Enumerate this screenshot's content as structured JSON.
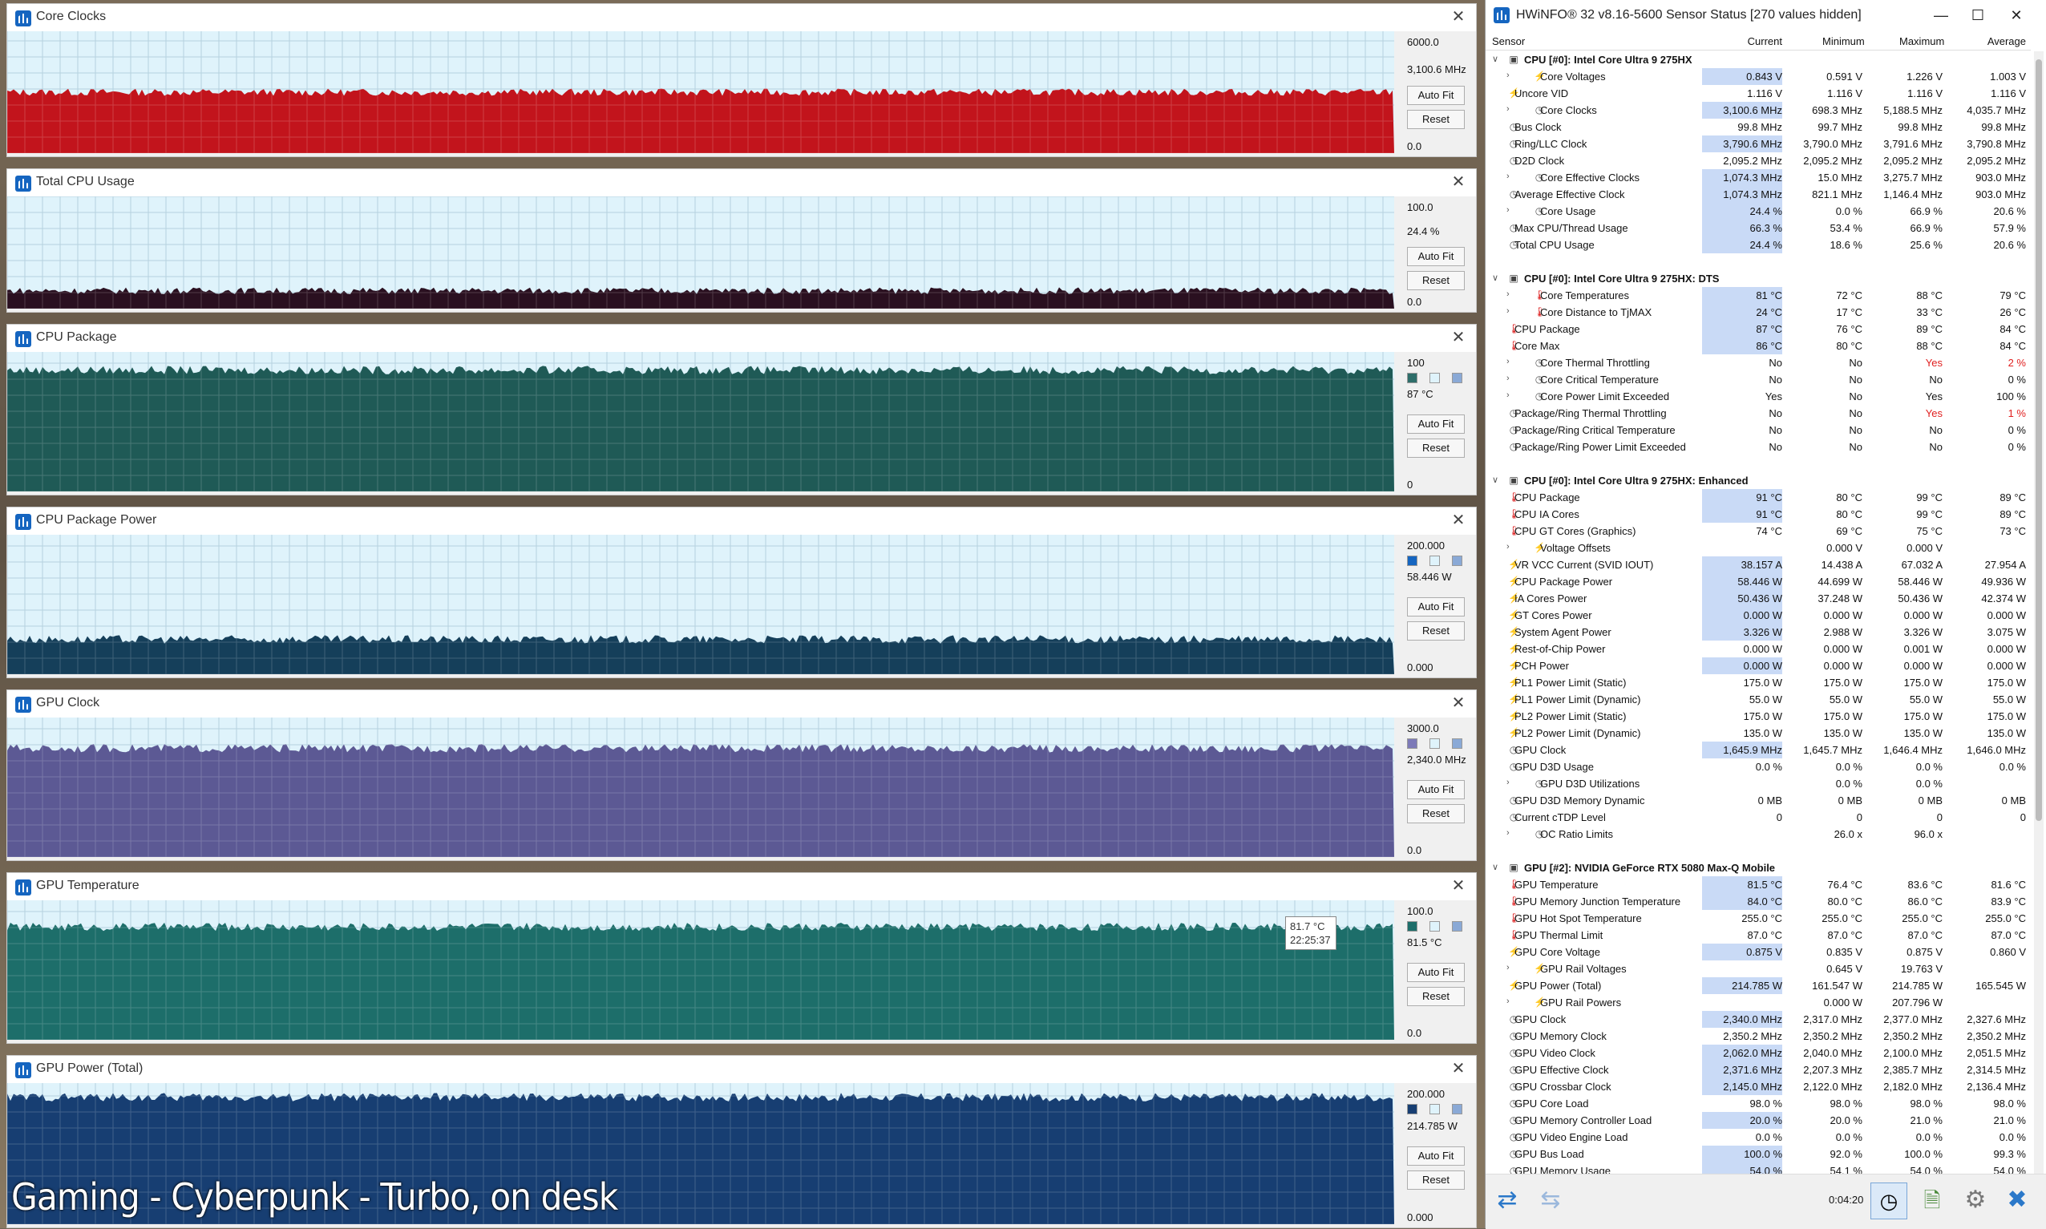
{
  "caption": "Gaming - Cyberpunk - Turbo, on desk",
  "graphs": [
    {
      "title": "Core Clocks",
      "max": "6000.0",
      "current": "3,100.6 MHz",
      "min": "0.0",
      "autofit": "Auto Fit",
      "reset": "Reset",
      "color": "#c2141c",
      "bg": "#dff3fb",
      "level": 0.5,
      "swatches": []
    },
    {
      "title": "Total CPU Usage",
      "max": "100.0",
      "current": "24.4 %",
      "min": "0.0",
      "autofit": "Auto Fit",
      "reset": "Reset",
      "color": "#2a1020",
      "bg": "#dff3fb",
      "level": 0.16,
      "swatches": []
    },
    {
      "title": "CPU Package",
      "max": "100",
      "current": "87 °C",
      "min": "0",
      "autofit": "Auto Fit",
      "reset": "Reset",
      "color": "#1f5a56",
      "bg": "#dff3fb",
      "level": 0.87,
      "swatches": [
        "#2e6e6a",
        "#dff3fb",
        "#8aa9d6"
      ]
    },
    {
      "title": "CPU Package Power",
      "max": "200.000",
      "current": "58.446 W",
      "min": "0.000",
      "autofit": "Auto Fit",
      "reset": "Reset",
      "color": "#153f5a",
      "bg": "#dff3fb",
      "level": 0.25,
      "swatches": [
        "#1565c0",
        "#dff3fb",
        "#8aa9d6"
      ]
    },
    {
      "title": "GPU Clock",
      "max": "3000.0",
      "current": "2,340.0 MHz",
      "min": "0.0",
      "autofit": "Auto Fit",
      "reset": "Reset",
      "color": "#5c5994",
      "bg": "#dff3fb",
      "level": 0.78,
      "swatches": [
        "#7d7ab8",
        "#dff3fb",
        "#8aa9d6"
      ]
    },
    {
      "title": "GPU Temperature",
      "max": "100.0",
      "current": "81.5 °C",
      "min": "0.0",
      "autofit": "Auto Fit",
      "reset": "Reset",
      "color": "#1d6e6a",
      "bg": "#dff3fb",
      "level": 0.81,
      "swatches": [
        "#1d6e6a",
        "#dff3fb",
        "#8aa9d6"
      ]
    },
    {
      "title": "GPU Power (Total)",
      "max": "200.000",
      "current": "214.785 W",
      "min": "0.000",
      "autofit": "Auto Fit",
      "reset": "Reset",
      "color": "#173e72",
      "bg": "#dff3fb",
      "level": 0.9,
      "swatches": [
        "#173e72",
        "#dff3fb",
        "#8aa9d6"
      ]
    }
  ],
  "tooltip": {
    "value": "81.7 °C",
    "time": "22:25:37"
  },
  "sensor": {
    "title": "HWiNFO® 32 v8.16-5600 Sensor Status [270 values hidden]",
    "columns": [
      "Sensor",
      "Current",
      "Minimum",
      "Maximum",
      "Average"
    ],
    "elapsed": "0:04:20",
    "rows": [
      {
        "g": 1,
        "n": "CPU [#0]: Intel Core Ultra 9 275HX"
      },
      {
        "e": 1,
        "i": "volt",
        "n": "Core Voltages",
        "c": "0.843 V",
        "mi": "0.591 V",
        "ma": "1.226 V",
        "a": "1.003 V",
        "h": 1
      },
      {
        "i": "volt",
        "n": "Uncore VID",
        "c": "1.116 V",
        "mi": "1.116 V",
        "ma": "1.116 V",
        "a": "1.116 V"
      },
      {
        "e": 1,
        "i": "clk",
        "n": "Core Clocks",
        "c": "3,100.6 MHz",
        "mi": "698.3 MHz",
        "ma": "5,188.5 MHz",
        "a": "4,035.7 MHz",
        "h": 1
      },
      {
        "i": "clk",
        "n": "Bus Clock",
        "c": "99.8 MHz",
        "mi": "99.7 MHz",
        "ma": "99.8 MHz",
        "a": "99.8 MHz"
      },
      {
        "i": "clk",
        "n": "Ring/LLC Clock",
        "c": "3,790.6 MHz",
        "mi": "3,790.0 MHz",
        "ma": "3,791.6 MHz",
        "a": "3,790.8 MHz",
        "h": 1
      },
      {
        "i": "clk",
        "n": "D2D Clock",
        "c": "2,095.2 MHz",
        "mi": "2,095.2 MHz",
        "ma": "2,095.2 MHz",
        "a": "2,095.2 MHz"
      },
      {
        "e": 1,
        "i": "clk",
        "n": "Core Effective Clocks",
        "c": "1,074.3 MHz",
        "mi": "15.0 MHz",
        "ma": "3,275.7 MHz",
        "a": "903.0 MHz",
        "h": 1
      },
      {
        "i": "clk",
        "n": "Average Effective Clock",
        "c": "1,074.3 MHz",
        "mi": "821.1 MHz",
        "ma": "1,146.4 MHz",
        "a": "903.0 MHz",
        "h": 1
      },
      {
        "e": 1,
        "i": "clk",
        "n": "Core Usage",
        "c": "24.4 %",
        "mi": "0.0 %",
        "ma": "66.9 %",
        "a": "20.6 %",
        "h": 1
      },
      {
        "i": "clk",
        "n": "Max CPU/Thread Usage",
        "c": "66.3 %",
        "mi": "53.4 %",
        "ma": "66.9 %",
        "a": "57.9 %",
        "h": 1
      },
      {
        "i": "clk",
        "n": "Total CPU Usage",
        "c": "24.4 %",
        "mi": "18.6 %",
        "ma": "25.6 %",
        "a": "20.6 %",
        "h": 1
      },
      {
        "s": 1
      },
      {
        "g": 1,
        "n": "CPU [#0]: Intel Core Ultra 9 275HX: DTS"
      },
      {
        "e": 1,
        "i": "temp",
        "n": "Core Temperatures",
        "c": "81 °C",
        "mi": "72 °C",
        "ma": "88 °C",
        "a": "79 °C",
        "h": 1
      },
      {
        "e": 1,
        "i": "temp",
        "n": "Core Distance to TjMAX",
        "c": "24 °C",
        "mi": "17 °C",
        "ma": "33 °C",
        "a": "26 °C",
        "h": 1
      },
      {
        "i": "temp",
        "n": "CPU Package",
        "c": "87 °C",
        "mi": "76 °C",
        "ma": "89 °C",
        "a": "84 °C",
        "h": 1
      },
      {
        "i": "temp",
        "n": "Core Max",
        "c": "86 °C",
        "mi": "80 °C",
        "ma": "88 °C",
        "a": "84 °C",
        "h": 1
      },
      {
        "e": 1,
        "i": "clk",
        "n": "Core Thermal Throttling",
        "c": "No",
        "mi": "No",
        "ma": "Yes",
        "a": "2 %",
        "r": 1
      },
      {
        "e": 1,
        "i": "clk",
        "n": "Core Critical Temperature",
        "c": "No",
        "mi": "No",
        "ma": "No",
        "a": "0 %"
      },
      {
        "e": 1,
        "i": "clk",
        "n": "Core Power Limit Exceeded",
        "c": "Yes",
        "mi": "No",
        "ma": "Yes",
        "a": "100 %"
      },
      {
        "i": "clk",
        "n": "Package/Ring Thermal Throttling",
        "c": "No",
        "mi": "No",
        "ma": "Yes",
        "a": "1 %",
        "r": 1
      },
      {
        "i": "clk",
        "n": "Package/Ring Critical Temperature",
        "c": "No",
        "mi": "No",
        "ma": "No",
        "a": "0 %"
      },
      {
        "i": "clk",
        "n": "Package/Ring Power Limit Exceeded",
        "c": "No",
        "mi": "No",
        "ma": "No",
        "a": "0 %"
      },
      {
        "s": 1
      },
      {
        "g": 1,
        "n": "CPU [#0]: Intel Core Ultra 9 275HX: Enhanced"
      },
      {
        "i": "temp",
        "n": "CPU Package",
        "c": "91 °C",
        "mi": "80 °C",
        "ma": "99 °C",
        "a": "89 °C",
        "h": 1
      },
      {
        "i": "temp",
        "n": "CPU IA Cores",
        "c": "91 °C",
        "mi": "80 °C",
        "ma": "99 °C",
        "a": "89 °C",
        "h": 1
      },
      {
        "i": "temp",
        "n": "CPU GT Cores (Graphics)",
        "c": "74 °C",
        "mi": "69 °C",
        "ma": "75 °C",
        "a": "73 °C"
      },
      {
        "e": 1,
        "i": "volt",
        "n": "Voltage Offsets",
        "c": "",
        "mi": "0.000 V",
        "ma": "0.000 V",
        "a": ""
      },
      {
        "i": "volt",
        "n": "VR VCC Current (SVID IOUT)",
        "c": "38.157 A",
        "mi": "14.438 A",
        "ma": "67.032 A",
        "a": "27.954 A",
        "h": 1
      },
      {
        "i": "volt",
        "n": "CPU Package Power",
        "c": "58.446 W",
        "mi": "44.699 W",
        "ma": "58.446 W",
        "a": "49.936 W",
        "h": 1
      },
      {
        "i": "volt",
        "n": "IA Cores Power",
        "c": "50.436 W",
        "mi": "37.248 W",
        "ma": "50.436 W",
        "a": "42.374 W",
        "h": 1
      },
      {
        "i": "volt",
        "n": "GT Cores Power",
        "c": "0.000 W",
        "mi": "0.000 W",
        "ma": "0.000 W",
        "a": "0.000 W",
        "h": 1
      },
      {
        "i": "volt",
        "n": "System Agent Power",
        "c": "3.326 W",
        "mi": "2.988 W",
        "ma": "3.326 W",
        "a": "3.075 W",
        "h": 1
      },
      {
        "i": "volt",
        "n": "Rest-of-Chip Power",
        "c": "0.000 W",
        "mi": "0.000 W",
        "ma": "0.001 W",
        "a": "0.000 W"
      },
      {
        "i": "volt",
        "n": "PCH Power",
        "c": "0.000 W",
        "mi": "0.000 W",
        "ma": "0.000 W",
        "a": "0.000 W",
        "h": 1
      },
      {
        "i": "volt",
        "n": "PL1 Power Limit (Static)",
        "c": "175.0 W",
        "mi": "175.0 W",
        "ma": "175.0 W",
        "a": "175.0 W"
      },
      {
        "i": "volt",
        "n": "PL1 Power Limit (Dynamic)",
        "c": "55.0 W",
        "mi": "55.0 W",
        "ma": "55.0 W",
        "a": "55.0 W"
      },
      {
        "i": "volt",
        "n": "PL2 Power Limit (Static)",
        "c": "175.0 W",
        "mi": "175.0 W",
        "ma": "175.0 W",
        "a": "175.0 W"
      },
      {
        "i": "volt",
        "n": "PL2 Power Limit (Dynamic)",
        "c": "135.0 W",
        "mi": "135.0 W",
        "ma": "135.0 W",
        "a": "135.0 W"
      },
      {
        "i": "clk",
        "n": "GPU Clock",
        "c": "1,645.9 MHz",
        "mi": "1,645.7 MHz",
        "ma": "1,646.4 MHz",
        "a": "1,646.0 MHz",
        "h": 1
      },
      {
        "i": "clk",
        "n": "GPU D3D Usage",
        "c": "0.0 %",
        "mi": "0.0 %",
        "ma": "0.0 %",
        "a": "0.0 %"
      },
      {
        "e": 1,
        "i": "clk",
        "n": "GPU D3D Utilizations",
        "c": "",
        "mi": "0.0 %",
        "ma": "0.0 %",
        "a": ""
      },
      {
        "i": "clk",
        "n": "GPU D3D Memory Dynamic",
        "c": "0 MB",
        "mi": "0 MB",
        "ma": "0 MB",
        "a": "0 MB"
      },
      {
        "i": "clk",
        "n": "Current cTDP Level",
        "c": "0",
        "mi": "0",
        "ma": "0",
        "a": "0"
      },
      {
        "e": 1,
        "i": "clk",
        "n": "OC Ratio Limits",
        "c": "",
        "mi": "26.0 x",
        "ma": "96.0 x",
        "a": ""
      },
      {
        "s": 1
      },
      {
        "g": 1,
        "n": "GPU [#2]: NVIDIA  GeForce RTX 5080 Max-Q Mobile"
      },
      {
        "i": "temp",
        "n": "GPU Temperature",
        "c": "81.5 °C",
        "mi": "76.4 °C",
        "ma": "83.6 °C",
        "a": "81.6 °C",
        "h": 1
      },
      {
        "i": "temp",
        "n": "GPU Memory Junction Temperature",
        "c": "84.0 °C",
        "mi": "80.0 °C",
        "ma": "86.0 °C",
        "a": "83.9 °C",
        "h": 1
      },
      {
        "i": "temp",
        "n": "GPU Hot Spot Temperature",
        "c": "255.0 °C",
        "mi": "255.0 °C",
        "ma": "255.0 °C",
        "a": "255.0 °C"
      },
      {
        "i": "temp",
        "n": "GPU Thermal Limit",
        "c": "87.0 °C",
        "mi": "87.0 °C",
        "ma": "87.0 °C",
        "a": "87.0 °C"
      },
      {
        "i": "volt",
        "n": "GPU Core Voltage",
        "c": "0.875 V",
        "mi": "0.835 V",
        "ma": "0.875 V",
        "a": "0.860 V",
        "h": 1
      },
      {
        "e": 1,
        "i": "volt",
        "n": "GPU Rail Voltages",
        "c": "",
        "mi": "0.645 V",
        "ma": "19.763 V",
        "a": ""
      },
      {
        "i": "volt",
        "n": "GPU Power (Total)",
        "c": "214.785 W",
        "mi": "161.547 W",
        "ma": "214.785 W",
        "a": "165.545 W",
        "h": 1
      },
      {
        "e": 1,
        "i": "volt",
        "n": "GPU Rail Powers",
        "c": "",
        "mi": "0.000 W",
        "ma": "207.796 W",
        "a": ""
      },
      {
        "i": "clk",
        "n": "GPU Clock",
        "c": "2,340.0 MHz",
        "mi": "2,317.0 MHz",
        "ma": "2,377.0 MHz",
        "a": "2,327.6 MHz",
        "h": 1
      },
      {
        "i": "clk",
        "n": "GPU Memory Clock",
        "c": "2,350.2 MHz",
        "mi": "2,350.2 MHz",
        "ma": "2,350.2 MHz",
        "a": "2,350.2 MHz"
      },
      {
        "i": "clk",
        "n": "GPU Video Clock",
        "c": "2,062.0 MHz",
        "mi": "2,040.0 MHz",
        "ma": "2,100.0 MHz",
        "a": "2,051.5 MHz",
        "h": 1
      },
      {
        "i": "clk",
        "n": "GPU Effective Clock",
        "c": "2,371.6 MHz",
        "mi": "2,207.3 MHz",
        "ma": "2,385.7 MHz",
        "a": "2,314.5 MHz",
        "h": 1
      },
      {
        "i": "clk",
        "n": "GPU Crossbar Clock",
        "c": "2,145.0 MHz",
        "mi": "2,122.0 MHz",
        "ma": "2,182.0 MHz",
        "a": "2,136.4 MHz",
        "h": 1
      },
      {
        "i": "clk",
        "n": "GPU Core Load",
        "c": "98.0 %",
        "mi": "98.0 %",
        "ma": "98.0 %",
        "a": "98.0 %"
      },
      {
        "i": "clk",
        "n": "GPU Memory Controller Load",
        "c": "20.0 %",
        "mi": "20.0 %",
        "ma": "21.0 %",
        "a": "21.0 %",
        "h": 1
      },
      {
        "i": "clk",
        "n": "GPU Video Engine Load",
        "c": "0.0 %",
        "mi": "0.0 %",
        "ma": "0.0 %",
        "a": "0.0 %"
      },
      {
        "i": "clk",
        "n": "GPU Bus Load",
        "c": "100.0 %",
        "mi": "92.0 %",
        "ma": "100.0 %",
        "a": "99.3 %",
        "h": 1
      },
      {
        "i": "clk",
        "n": "GPU Memory Usage",
        "c": "54.0 %",
        "mi": "54.1 %",
        "ma": "54.0 %",
        "a": "54.0 %",
        "h": 1
      }
    ]
  }
}
